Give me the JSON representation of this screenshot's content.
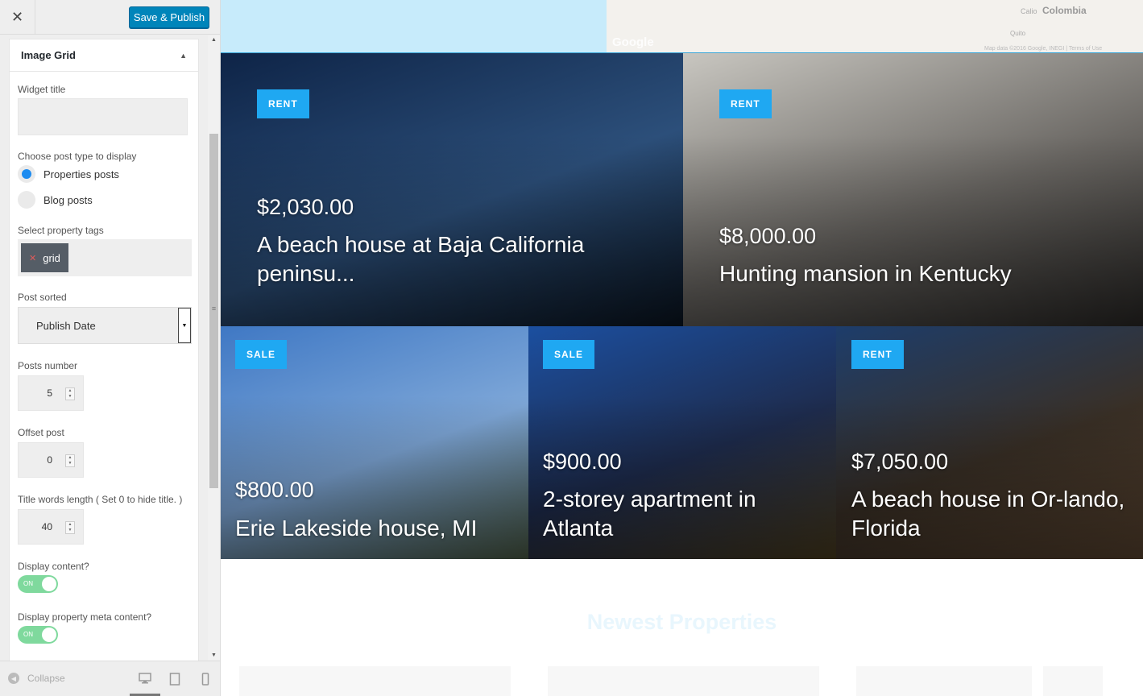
{
  "header": {
    "save_label": "Save & Publish"
  },
  "widget": {
    "title": "Image Grid",
    "widget_title_label": "Widget title",
    "widget_title_value": "",
    "post_type_label": "Choose post type to display",
    "post_type_options": [
      "Properties posts",
      "Blog posts"
    ],
    "post_type_selected": "Properties posts",
    "tags_label": "Select property tags",
    "tags": [
      "grid"
    ],
    "sorted_label": "Post sorted",
    "sorted_value": "Publish Date",
    "posts_number_label": "Posts number",
    "posts_number_value": "5",
    "offset_label": "Offset post",
    "offset_value": "0",
    "title_words_label": "Title words length ( Set 0 to hide title. )",
    "title_words_value": "40",
    "display_content_label": "Display content?",
    "display_content_state": "ON",
    "display_meta_label": "Display property meta content?",
    "display_meta_state": "ON"
  },
  "footer": {
    "collapse_label": "Collapse"
  },
  "map": {
    "google_label": "Google",
    "country_label": "Colombia",
    "city1": "Calio",
    "city2": "Quito",
    "copyright": "Map data ©2016 Google, INEGI | Terms of Use"
  },
  "properties": [
    {
      "badge": "RENT",
      "price": "$2,030.00",
      "title": "A beach house at Baja California peninsu...",
      "colors": [
        "#0e2447",
        "#2c4f7a",
        "#0a1420"
      ]
    },
    {
      "badge": "RENT",
      "price": "$8,000.00",
      "title": "Hunting mansion in Kentucky",
      "colors": [
        "#c8c6c0",
        "#6b6864",
        "#2a2826"
      ]
    },
    {
      "badge": "SALE",
      "price": "$800.00",
      "title": "Erie Lakeside house, MI",
      "colors": [
        "#3f78c4",
        "#7ea7d8",
        "#4a5a44"
      ]
    },
    {
      "badge": "SALE",
      "price": "$900.00",
      "title": "2-storey apartment in Atlanta",
      "colors": [
        "#1b4fa0",
        "#1e2c4e",
        "#4a3c1e"
      ]
    },
    {
      "badge": "RENT",
      "price": "$7,050.00",
      "title": "A beach house in Or-lando, Florida",
      "colors": [
        "#1d3d6b",
        "#3a3026",
        "#5a4430"
      ]
    }
  ],
  "section": {
    "newest_title": "Newest Properties"
  },
  "accent": "#1fa8f2",
  "primary_button": "#0085ba"
}
